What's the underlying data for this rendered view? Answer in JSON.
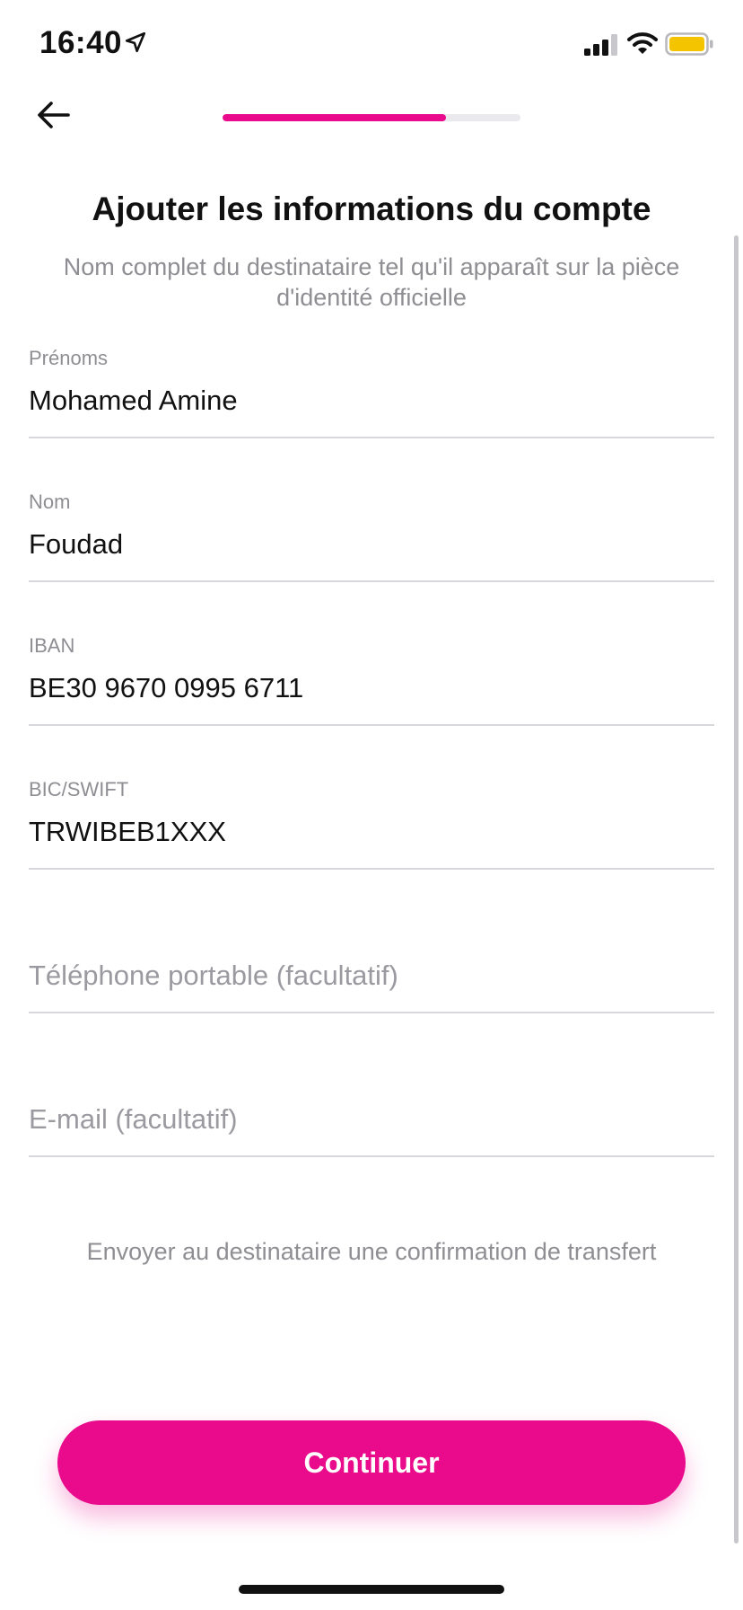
{
  "status_bar": {
    "time": "16:40",
    "icons": [
      "location-arrow-icon",
      "cellular-signal-icon",
      "wifi-icon",
      "battery-icon"
    ],
    "battery_color": "#f5c400"
  },
  "nav": {
    "back_icon": "arrow-left-icon",
    "progress_fraction": 0.75
  },
  "header": {
    "title": "Ajouter les informations du compte",
    "subtitle": "Nom complet du destinataire tel qu'il apparaît sur la pièce d'identité officielle"
  },
  "fields": {
    "first_name": {
      "label": "Prénoms",
      "value": "Mohamed Amine"
    },
    "last_name": {
      "label": "Nom",
      "value": "Foudad"
    },
    "iban": {
      "label": "IBAN",
      "value": "BE30 9670 0995 6711"
    },
    "bic": {
      "label": "BIC/SWIFT",
      "value": "TRWIBEB1XXX"
    },
    "phone": {
      "placeholder": "Téléphone portable (facultatif)"
    },
    "email": {
      "placeholder": "E-mail (facultatif)"
    }
  },
  "confirmation_note": "Envoyer au destinataire une confirmation de transfert",
  "continue_button": {
    "label": "Continuer"
  },
  "colors": {
    "accent": "#ea0a8c",
    "muted_text": "#8e8e93",
    "divider": "#d7d7dc"
  }
}
